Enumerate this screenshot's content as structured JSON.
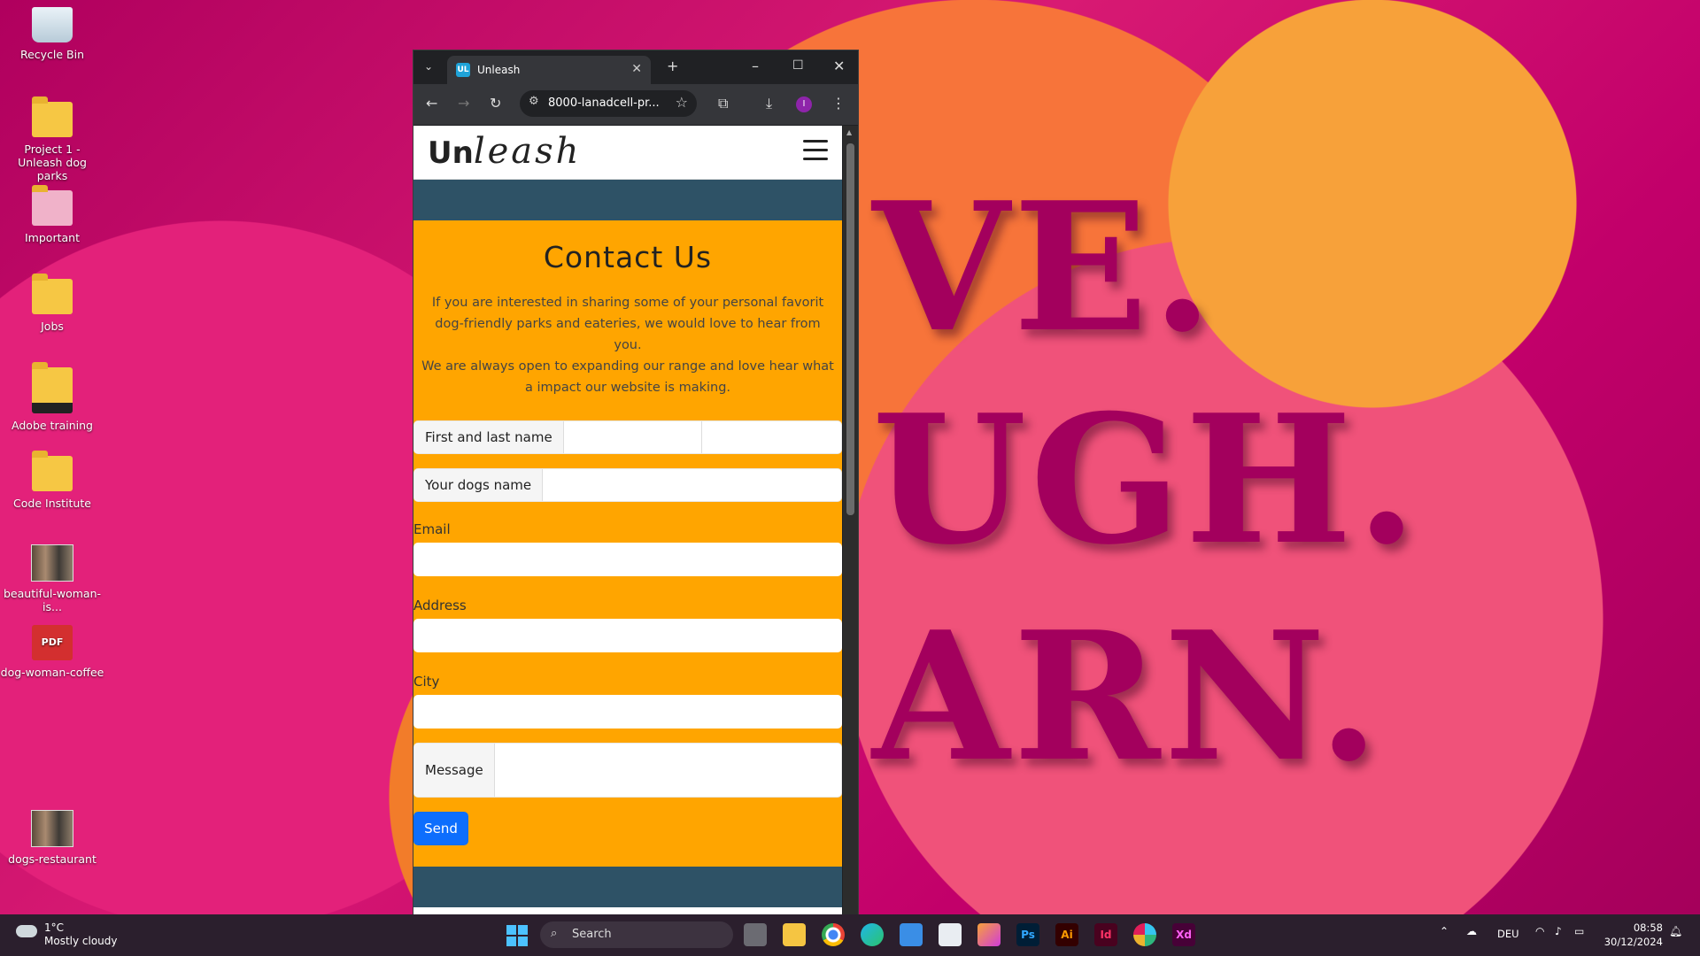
{
  "desktop": {
    "wallpaper_words": [
      "VE.",
      "UGH.",
      "ARN."
    ],
    "icons": [
      {
        "label": "Recycle Bin",
        "icon": "recycle-bin-icon"
      },
      {
        "label": "Project 1 - Unleash dog parks",
        "icon": "folder-icon"
      },
      {
        "label": "Important",
        "icon": "folder-icon"
      },
      {
        "label": "Jobs",
        "icon": "folder-icon"
      },
      {
        "label": "Adobe training",
        "icon": "folder-icon"
      },
      {
        "label": "Code Institute",
        "icon": "folder-icon"
      },
      {
        "label": "beautiful-woman-is...",
        "icon": "image-file-icon"
      },
      {
        "label": "dog-woman-coffee",
        "icon": "pdf-file-icon"
      },
      {
        "label": "dogs-restaurant",
        "icon": "image-file-icon"
      }
    ],
    "pdf_icon_text": "PDF"
  },
  "browser": {
    "tab_title": "Unleash",
    "favicon_text": "UL",
    "url": "8000-lanadcell-pr...",
    "profile_initial": "I"
  },
  "page": {
    "brand_bold": "Un",
    "brand_italic": "leash",
    "contact_title": "Contact Us",
    "intro_line1": "If you are interested in sharing some of your personal favorit dog-friendly parks and eateries, we would love to hear from you.",
    "intro_line2": "We are always open to expanding our range and love hear what a impact our website is making.",
    "form": {
      "name_label": "First and last name",
      "dog_label": "Your dogs name",
      "email_label": "Email",
      "address_label": "Address",
      "city_label": "City",
      "message_label": "Message",
      "send_label": "Send"
    },
    "colors": {
      "nav_band": "#2e5266",
      "contact_bg": "#ffa500",
      "send_button": "#0d6efd"
    }
  },
  "taskbar": {
    "temperature": "1°C",
    "weather": "Mostly cloudy",
    "search_placeholder": "Search",
    "language": "DEU",
    "time": "08:58",
    "date": "30/12/2024",
    "apps": [
      {
        "name": "file-explorer",
        "label": ""
      },
      {
        "name": "chrome",
        "label": ""
      },
      {
        "name": "edge",
        "label": ""
      },
      {
        "name": "store",
        "label": ""
      },
      {
        "name": "calendar",
        "label": ""
      },
      {
        "name": "photos",
        "label": ""
      },
      {
        "name": "photoshop",
        "label": "Ps"
      },
      {
        "name": "illustrator",
        "label": "Ai"
      },
      {
        "name": "indesign",
        "label": "Id"
      },
      {
        "name": "slack",
        "label": ""
      },
      {
        "name": "xd",
        "label": "Xd"
      }
    ]
  }
}
